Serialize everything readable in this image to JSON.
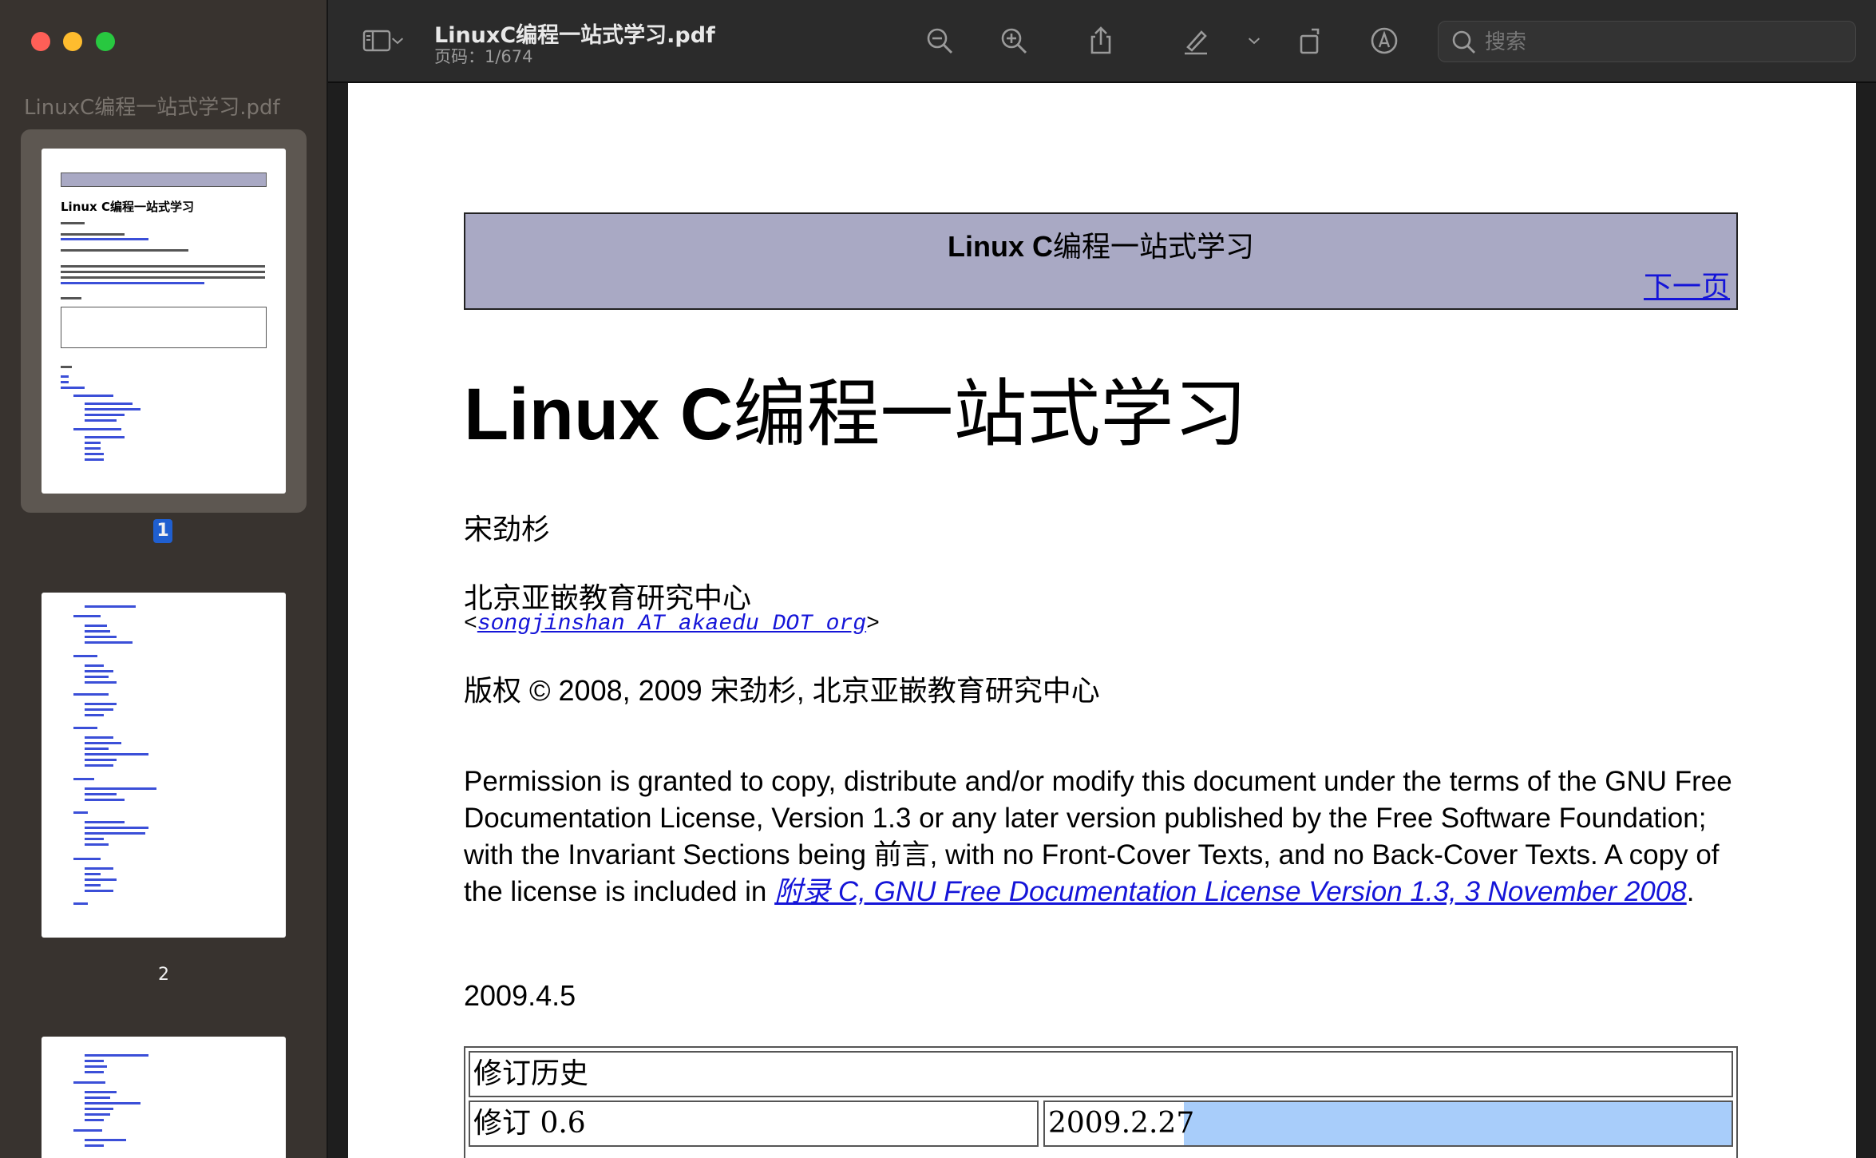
{
  "window": {
    "title": "LinuxC编程一站式学习.pdf",
    "page_indicator": "页码：1/674"
  },
  "sidebar": {
    "title": "LinuxC编程一站式学习.pdf",
    "thumbnails": [
      {
        "page_label": "1",
        "selected": true
      },
      {
        "page_label": "2",
        "selected": false
      },
      {
        "page_label": "",
        "selected": false
      }
    ]
  },
  "toolbar": {
    "icons": [
      "sidebar-icon",
      "chevron-down-icon",
      "zoom-out-icon",
      "zoom-in-icon",
      "share-icon",
      "highlight-icon",
      "chevron-down-icon",
      "rotate-icon",
      "markup-icon",
      "search-icon"
    ]
  },
  "search": {
    "placeholder": "搜索"
  },
  "document": {
    "header_title_latin": "Linux C",
    "header_title_cn": "编程一站式学习",
    "next_link": "下一页",
    "title_latin": "Linux C",
    "title_cn": "编程一站式学习",
    "author": "宋劲杉",
    "organization": "北京亚嵌教育研究中心",
    "email_open": "<",
    "email": "songjinshan AT akaedu DOT org",
    "email_close": ">",
    "copyright": "版权 © 2008, 2009 宋劲杉, 北京亚嵌教育研究中心",
    "permission_text": "Permission is granted to copy, distribute and/or modify this document under the terms of the GNU Free Documentation License, Version 1.3 or any later version published by the Free Software Foundation; with the Invariant Sections being 前言, with no Front-Cover Texts, and no Back-Cover Texts. A copy of the license is included in ",
    "license_link": "附录 C, GNU Free Documentation License Version 1.3, 3 November 2008",
    "permission_end": ".",
    "pubdate": "2009.4.5",
    "revision_history": {
      "header": "修订历史",
      "version": "修订 0.6",
      "date": "2009.2.27"
    }
  }
}
